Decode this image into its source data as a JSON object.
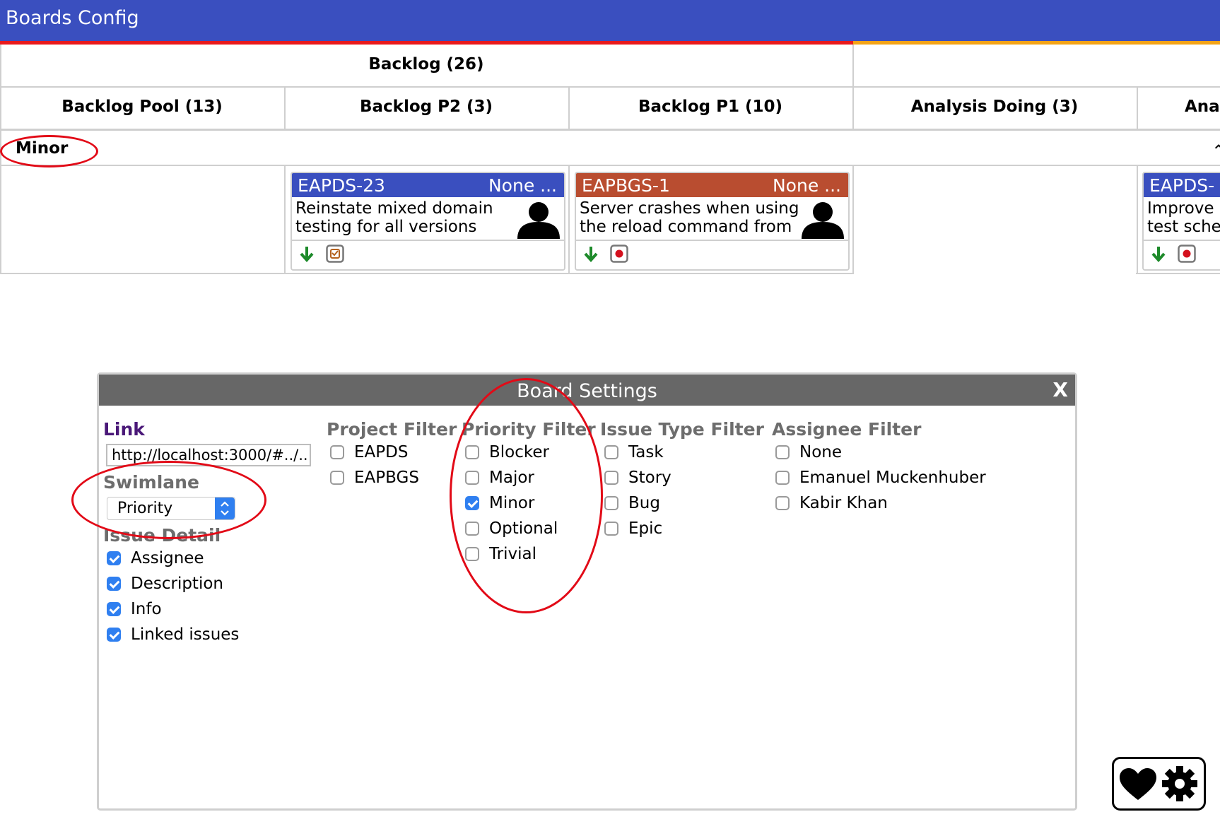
{
  "app": {
    "title": "Boards Config"
  },
  "board": {
    "top_header": "Backlog (26)",
    "columns": [
      "Backlog Pool (13)",
      "Backlog P2 (3)",
      "Backlog P1 (10)",
      "Analysis Doing (3)",
      "Ana"
    ],
    "swimlane_label": "Minor",
    "cards": [
      {
        "key": "EAPDS-23",
        "priority": "None ...",
        "header_color": "#3a4fbf",
        "description": [
          "Reinstate mixed domain",
          "testing for all versions"
        ],
        "type_icon": "task-icon"
      },
      {
        "key": "EAPBGS-1",
        "priority": "None ...",
        "header_color": "#b94d30",
        "description": [
          "Server crashes when using",
          "the reload command from"
        ],
        "type_icon": "bug-icon"
      },
      {
        "key": "EAPDS-",
        "priority": "",
        "header_color": "#3a4fbf",
        "description": [
          "Improve",
          "test sche"
        ],
        "type_icon": "bug-icon"
      }
    ]
  },
  "dialog": {
    "title": "Board Settings",
    "close_label": "X",
    "link": {
      "label": "Link",
      "value": "http://localhost:3000/#../.."
    },
    "swimlane": {
      "label": "Swimlane",
      "selected": "Priority"
    },
    "issue_detail": {
      "label": "Issue Detail",
      "items": [
        {
          "label": "Assignee",
          "checked": true
        },
        {
          "label": "Description",
          "checked": true
        },
        {
          "label": "Info",
          "checked": true
        },
        {
          "label": "Linked issues",
          "checked": true
        }
      ]
    },
    "project_filter": {
      "label": "Project Filter",
      "items": [
        {
          "label": "EAPDS",
          "checked": false
        },
        {
          "label": "EAPBGS",
          "checked": false
        }
      ]
    },
    "priority_filter": {
      "label": "Priority Filter",
      "items": [
        {
          "label": "Blocker",
          "checked": false
        },
        {
          "label": "Major",
          "checked": false
        },
        {
          "label": "Minor",
          "checked": true
        },
        {
          "label": "Optional",
          "checked": false
        },
        {
          "label": "Trivial",
          "checked": false
        }
      ]
    },
    "issue_type_filter": {
      "label": "Issue Type Filter",
      "items": [
        {
          "label": "Task",
          "checked": false
        },
        {
          "label": "Story",
          "checked": false
        },
        {
          "label": "Bug",
          "checked": false
        },
        {
          "label": "Epic",
          "checked": false
        }
      ]
    },
    "assignee_filter": {
      "label": "Assignee Filter",
      "items": [
        {
          "label": "None",
          "checked": false
        },
        {
          "label": "Emanuel Muckenhuber",
          "checked": false
        },
        {
          "label": "Kabir Khan",
          "checked": false
        }
      ]
    }
  },
  "controls": {
    "icons": [
      "heart-icon",
      "gear-icon"
    ]
  },
  "colors": {
    "accent": "#3a4fbf",
    "annotation": "#e20a17",
    "checkbox": "#2f7ff0"
  }
}
